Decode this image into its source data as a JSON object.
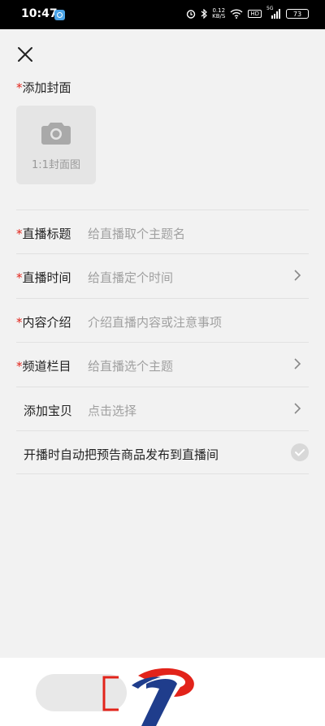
{
  "status": {
    "time": "10:47",
    "net_speed_value": "0.12",
    "net_speed_unit": "KB/S",
    "hd_label": "HD",
    "net_type": "5G",
    "battery": "73"
  },
  "cover": {
    "required_mark": "*",
    "label": "添加封面",
    "placeholder": "1:1封面图"
  },
  "form": {
    "rows": [
      {
        "required": "*",
        "label": "直播标题",
        "placeholder": "给直播取个主题名"
      },
      {
        "required": "*",
        "label": "直播时间",
        "placeholder": "给直播定个时间"
      },
      {
        "required": "*",
        "label": "内容介绍",
        "placeholder": "介绍直播内容或注意事项"
      },
      {
        "required": "*",
        "label": "频道栏目",
        "placeholder": "给直播选个主题"
      },
      {
        "required": "",
        "label": "添加宝贝",
        "placeholder": "点击选择"
      }
    ],
    "auto_publish_label": "开播时自动把预告商品发布到直播间"
  },
  "colors": {
    "required": "#e2231a",
    "placeholder": "#a0a0a0",
    "background": "#f2f2f2"
  }
}
